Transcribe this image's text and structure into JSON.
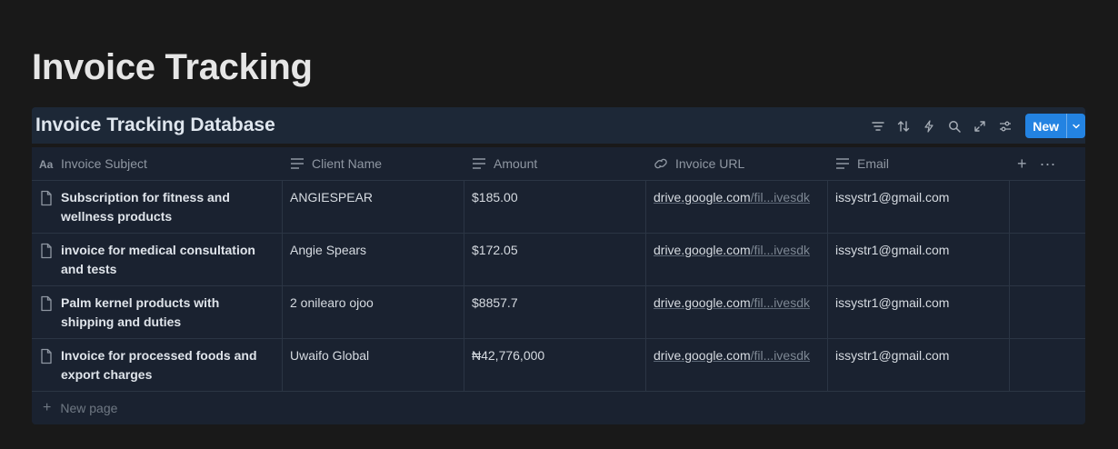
{
  "page": {
    "title": "Invoice Tracking"
  },
  "database": {
    "title": "Invoice Tracking Database",
    "toolbar": {
      "icons": [
        "filter-icon",
        "sort-icon",
        "automation-icon",
        "search-icon",
        "expand-icon",
        "settings-icon"
      ],
      "new_label": "New"
    },
    "columns": [
      {
        "label": "Invoice Subject",
        "icon": "title-icon"
      },
      {
        "label": "Client Name",
        "icon": "text-icon"
      },
      {
        "label": "Amount",
        "icon": "text-icon"
      },
      {
        "label": "Invoice URL",
        "icon": "link-icon"
      },
      {
        "label": "Email",
        "icon": "text-icon"
      }
    ],
    "header_actions": {
      "add": "+",
      "more": "···"
    },
    "rows": [
      {
        "subject": "Subscription for fitness and wellness products",
        "client": "ANGIESPEAR",
        "amount": "$185.00",
        "url_main": "drive.google.com",
        "url_tail": "/fil...ivesdk",
        "email": "issystr1@gmail.com"
      },
      {
        "subject": "invoice for medical consultation and tests",
        "client": "Angie Spears",
        "amount": "$172.05",
        "url_main": "drive.google.com",
        "url_tail": "/fil...ivesdk",
        "email": "issystr1@gmail.com"
      },
      {
        "subject": "Palm kernel products with shipping and duties",
        "client": "2 onilearo ojoo",
        "amount": "$8857.7",
        "url_main": "drive.google.com",
        "url_tail": "/fil...ivesdk",
        "email": "issystr1@gmail.com"
      },
      {
        "subject": "Invoice for processed foods and export charges",
        "client": "Uwaifo Global",
        "amount": "₦42,776,000",
        "url_main": "drive.google.com",
        "url_tail": "/fil...ivesdk",
        "email": "issystr1@gmail.com"
      }
    ],
    "new_page_label": "New page"
  },
  "colors": {
    "accent": "#2383e2",
    "background": "#191919",
    "panel": "#1a2230"
  }
}
